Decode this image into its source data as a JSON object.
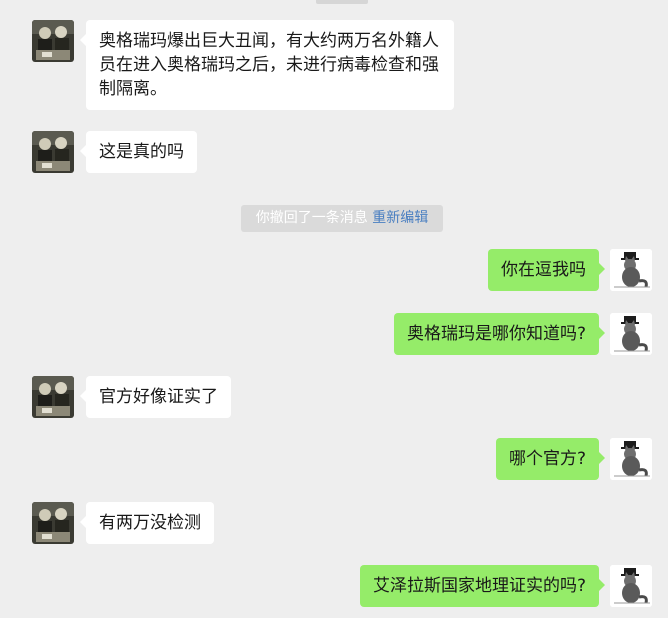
{
  "colors": {
    "background": "#eeeeee",
    "incoming_bubble": "#ffffff",
    "outgoing_bubble": "#95ec69",
    "notice_background": "#dadada",
    "link": "#4a7fc1"
  },
  "contact_avatar_icon": "group-photo-avatar-icon",
  "self_avatar_icon": "cat-with-top-hat-avatar-icon",
  "messages": [
    {
      "side": "left",
      "text": "奥格瑞玛爆出巨大丑闻，有大约两万名外籍人员在进入奥格瑞玛之后，未进行病毒检查和强制隔离。"
    },
    {
      "side": "left",
      "text": "这是真的吗"
    },
    {
      "side": "right",
      "text": "你在逗我吗"
    },
    {
      "side": "right",
      "text": "奥格瑞玛是哪你知道吗?"
    },
    {
      "side": "left",
      "text": "官方好像证实了"
    },
    {
      "side": "right",
      "text": "哪个官方?"
    },
    {
      "side": "left",
      "text": "有两万没检测"
    },
    {
      "side": "right",
      "text": "艾泽拉斯国家地理证实的吗?"
    }
  ],
  "system_notice": {
    "text": "你撤回了一条消息",
    "action": "重新编辑"
  }
}
